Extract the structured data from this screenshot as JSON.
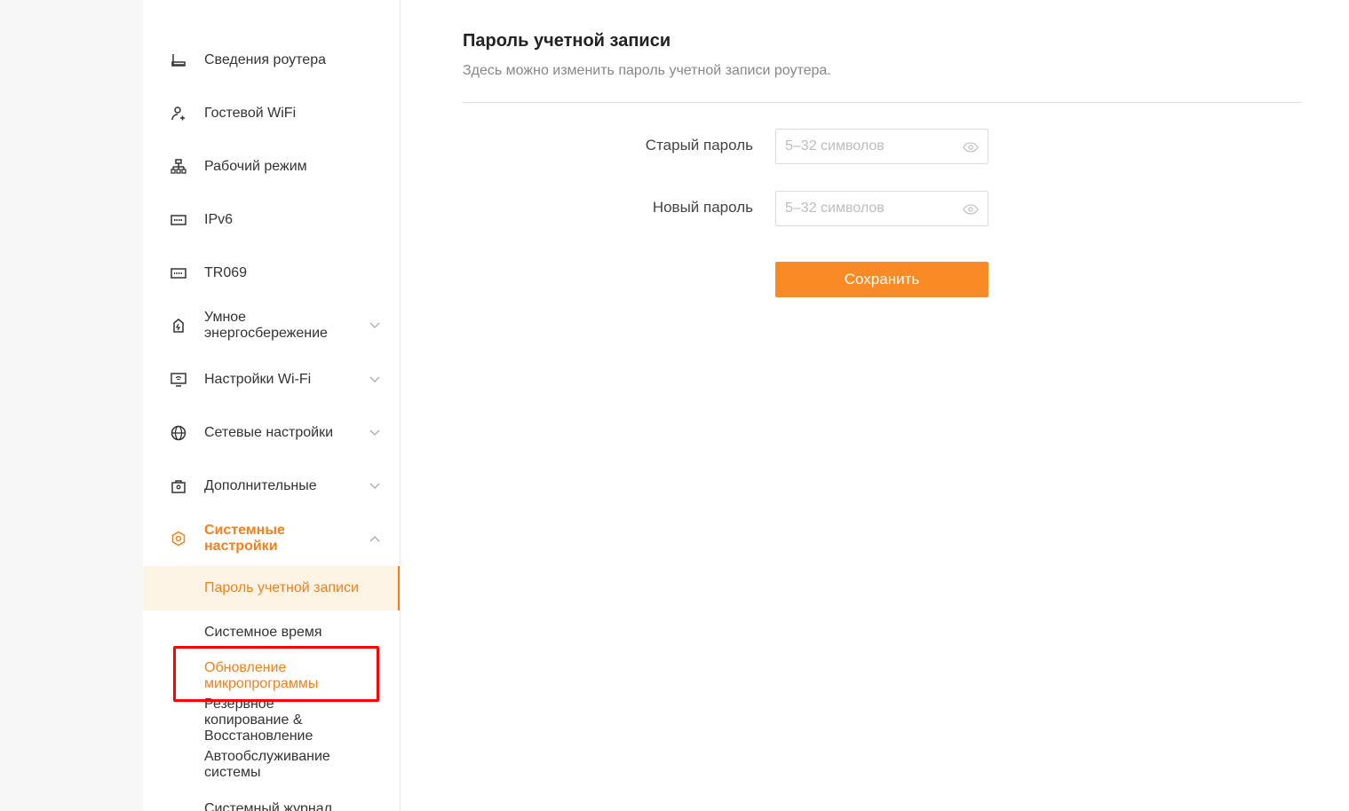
{
  "sidebar": {
    "items": [
      {
        "label": "Сведения роутера",
        "icon": "router-icon"
      },
      {
        "label": "Гостевой WiFi",
        "icon": "guest-user-icon"
      },
      {
        "label": "Рабочий режим",
        "icon": "network-tree-icon"
      },
      {
        "label": "IPv6",
        "icon": "ipv6-icon"
      },
      {
        "label": "TR069",
        "icon": "tr069-icon"
      },
      {
        "label": "Умное энергосбережение",
        "icon": "energy-saving-icon"
      },
      {
        "label": "Настройки Wi-Fi",
        "icon": "wifi-settings-icon"
      },
      {
        "label": "Сетевые настройки",
        "icon": "globe-icon"
      },
      {
        "label": "Дополнительные",
        "icon": "advanced-lock-icon"
      },
      {
        "label": "Системные настройки",
        "icon": "system-settings-icon"
      }
    ],
    "sub_items": [
      {
        "label": "Пароль учетной записи"
      },
      {
        "label": "Системное время"
      },
      {
        "label": "Обновление микропрограммы"
      },
      {
        "label": "Резервное копирование & Восстановление"
      },
      {
        "label": "Автообслуживание системы"
      },
      {
        "label": "Системный журнал"
      }
    ]
  },
  "main": {
    "title": "Пароль учетной записи",
    "description": "Здесь можно изменить пароль учетной записи роутера.",
    "old_password_label": "Старый пароль",
    "old_password_placeholder": "5–32 символов",
    "new_password_label": "Новый пароль",
    "new_password_placeholder": "5–32 символов",
    "save_label": "Сохранить"
  },
  "colors": {
    "accent": "#f5801f",
    "button": "#f98a25",
    "selected_bg": "#fef4e6",
    "highlight_box": "#ff0000"
  }
}
